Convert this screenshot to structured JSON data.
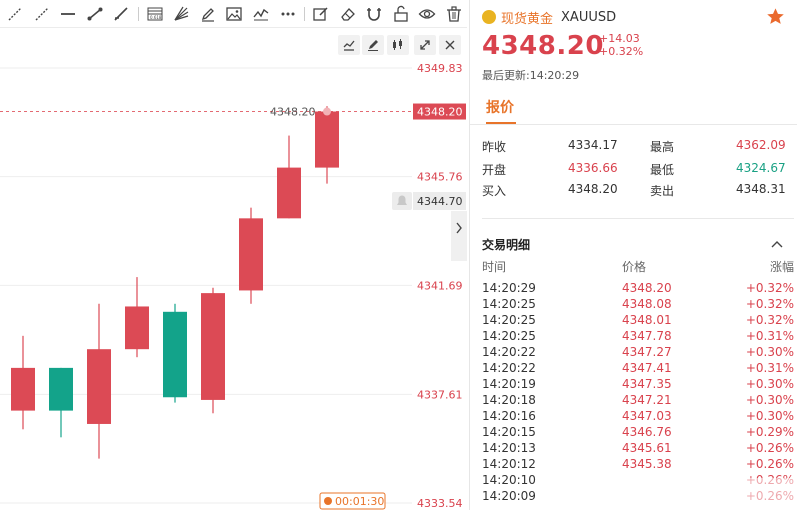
{
  "header": {
    "name": "现货黄金",
    "symbol": "XAUUSD",
    "price": "4348.20",
    "change": "+14.03",
    "change_pct": "+0.32%",
    "updated": "最后更新:14:20:29"
  },
  "tabs": {
    "quote": "报价"
  },
  "stats": {
    "prev_close_label": "昨收",
    "prev_close": "4334.17",
    "high_label": "最高",
    "high": "4362.09",
    "open_label": "开盘",
    "open": "4336.66",
    "low_label": "最低",
    "low": "4324.67",
    "bid_label": "买入",
    "bid": "4348.20",
    "ask_label": "卖出",
    "ask": "4348.31"
  },
  "trades": {
    "title": "交易明细",
    "col_time": "时间",
    "col_price": "价格",
    "col_change": "涨幅",
    "rows": [
      {
        "time": "14:20:29",
        "price": "4348.20",
        "pct": "+0.32%"
      },
      {
        "time": "14:20:25",
        "price": "4348.08",
        "pct": "+0.32%"
      },
      {
        "time": "14:20:25",
        "price": "4348.01",
        "pct": "+0.32%"
      },
      {
        "time": "14:20:25",
        "price": "4347.78",
        "pct": "+0.31%"
      },
      {
        "time": "14:20:22",
        "price": "4347.27",
        "pct": "+0.30%"
      },
      {
        "time": "14:20:22",
        "price": "4347.41",
        "pct": "+0.31%"
      },
      {
        "time": "14:20:19",
        "price": "4347.35",
        "pct": "+0.30%"
      },
      {
        "time": "14:20:18",
        "price": "4347.21",
        "pct": "+0.30%"
      },
      {
        "time": "14:20:16",
        "price": "4347.03",
        "pct": "+0.30%"
      },
      {
        "time": "14:20:15",
        "price": "4346.76",
        "pct": "+0.29%"
      },
      {
        "time": "14:20:13",
        "price": "4345.61",
        "pct": "+0.26%"
      },
      {
        "time": "14:20:12",
        "price": "4345.38",
        "pct": "+0.26%"
      },
      {
        "time": "14:20:10",
        "price": "",
        "pct": "+0.26%"
      },
      {
        "time": "14:20:09",
        "price": "",
        "pct": "+0.26%"
      }
    ]
  },
  "chart": {
    "price_labels": [
      "4349.83",
      "4345.76",
      "4341.69",
      "4337.61",
      "4333.54"
    ],
    "last_price": "4348.20",
    "marker_price": "4344.70",
    "countdown": "00:01:30"
  },
  "chart_data": {
    "type": "candlestick",
    "ylim": [
      4333.54,
      4349.83
    ],
    "candles": [
      {
        "open": 4337.0,
        "high": 4339.8,
        "low": 4336.3,
        "close": 4338.6
      },
      {
        "open": 4338.6,
        "high": 4338.6,
        "low": 4336.0,
        "close": 4337.0
      },
      {
        "open": 4336.5,
        "high": 4341.0,
        "low": 4335.2,
        "close": 4339.3
      },
      {
        "open": 4339.3,
        "high": 4342.0,
        "low": 4339.0,
        "close": 4340.9
      },
      {
        "open": 4340.7,
        "high": 4341.0,
        "low": 4337.3,
        "close": 4337.5
      },
      {
        "open": 4337.4,
        "high": 4341.6,
        "low": 4336.9,
        "close": 4341.4
      },
      {
        "open": 4341.5,
        "high": 4344.6,
        "low": 4341.0,
        "close": 4344.2
      },
      {
        "open": 4344.2,
        "high": 4347.3,
        "low": 4344.2,
        "close": 4346.1
      },
      {
        "open": 4346.1,
        "high": 4348.4,
        "low": 4345.5,
        "close": 4348.2
      }
    ]
  },
  "colors": {
    "up": "#dc4a55",
    "down": "#13a38a",
    "accent": "#e8742a"
  }
}
